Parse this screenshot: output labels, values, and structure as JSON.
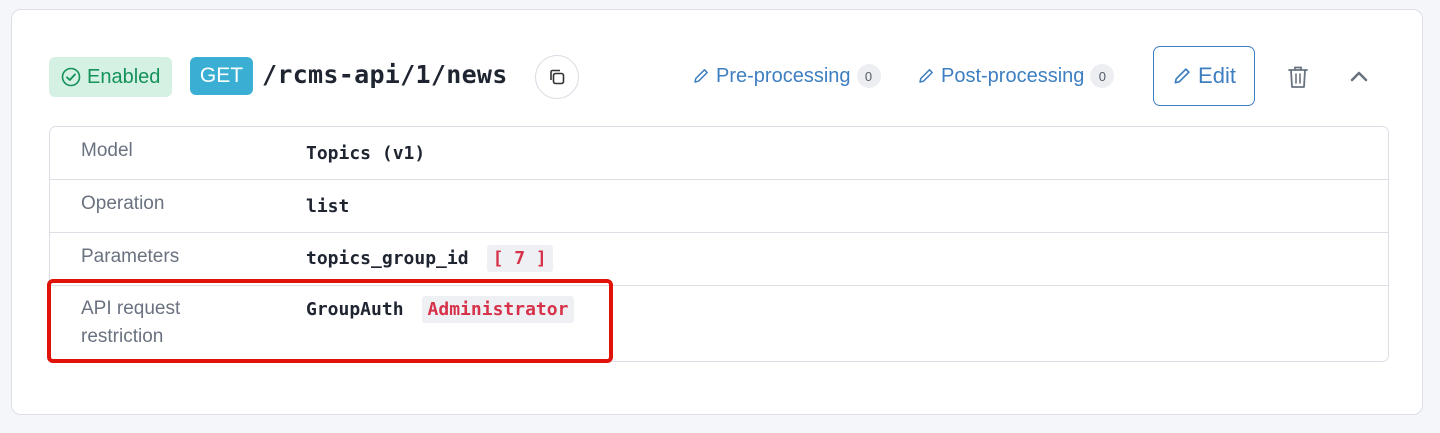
{
  "endpoint": {
    "status": "Enabled",
    "method": "GET",
    "path": "/rcms-api/1/news",
    "pre_processing": {
      "label": "Pre-processing",
      "count": "0"
    },
    "post_processing": {
      "label": "Post-processing",
      "count": "0"
    },
    "edit_label": "Edit"
  },
  "details": {
    "rows": [
      {
        "label": "Model",
        "value": "Topics (v1)"
      },
      {
        "label": "Operation",
        "value": "list"
      },
      {
        "label": "Parameters",
        "value": "topics_group_id",
        "tag": "[ 7 ]"
      },
      {
        "label": "API request\nrestriction",
        "value": "GroupAuth",
        "tag": "Administrator"
      }
    ]
  },
  "colors": {
    "enabled_bg": "#d4f1e3",
    "enabled_text": "#15915a",
    "method_bg": "#3aafd3",
    "link": "#3e7fc1",
    "tag_text": "#d6334a",
    "highlight": "#e0120a"
  }
}
